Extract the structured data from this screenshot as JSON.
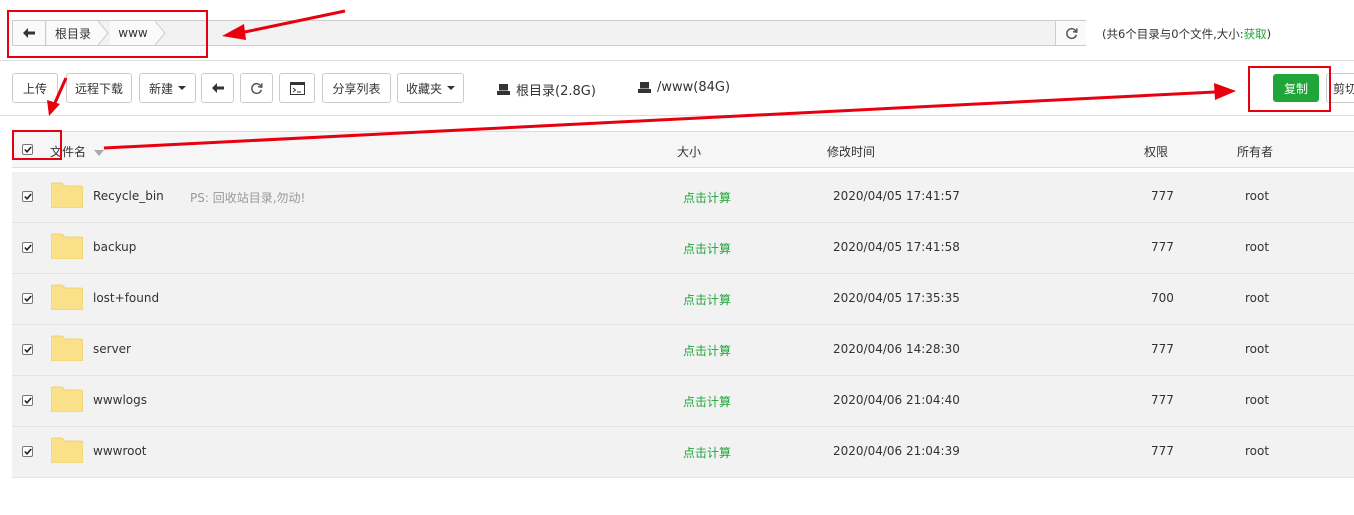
{
  "path": {
    "crumbs": [
      "根目录",
      "www"
    ],
    "summary_text": "(共6个目录与0个文件,大小:",
    "summary_link": "获取",
    "summary_end": ")"
  },
  "toolbar": {
    "upload": "上传",
    "remote_download": "远程下载",
    "new": "新建",
    "share_list": "分享列表",
    "favorites": "收藏夹",
    "disk_root": "根目录(2.8G)",
    "disk_www": "/www(84G)",
    "copy": "复制",
    "cut": "剪切"
  },
  "table": {
    "columns": {
      "name": "文件名",
      "size": "大小",
      "mtime": "修改时间",
      "perm": "权限",
      "owner": "所有者"
    },
    "rows": [
      {
        "name": "Recycle_bin",
        "note": "PS: 回收站目录,勿动!",
        "size": "点击计算",
        "mtime": "2020/04/05 17:41:57",
        "perm": "777",
        "owner": "root"
      },
      {
        "name": "backup",
        "note": "",
        "size": "点击计算",
        "mtime": "2020/04/05 17:41:58",
        "perm": "777",
        "owner": "root"
      },
      {
        "name": "lost+found",
        "note": "",
        "size": "点击计算",
        "mtime": "2020/04/05 17:35:35",
        "perm": "700",
        "owner": "root"
      },
      {
        "name": "server",
        "note": "",
        "size": "点击计算",
        "mtime": "2020/04/06 14:28:30",
        "perm": "777",
        "owner": "root"
      },
      {
        "name": "wwwlogs",
        "note": "",
        "size": "点击计算",
        "mtime": "2020/04/06 21:04:40",
        "perm": "777",
        "owner": "root"
      },
      {
        "name": "wwwroot",
        "note": "",
        "size": "点击计算",
        "mtime": "2020/04/06 21:04:39",
        "perm": "777",
        "owner": "root"
      }
    ]
  },
  "colors": {
    "accent": "#20a53a",
    "annotation": "#e8000e",
    "folder": "#fbe08a"
  }
}
